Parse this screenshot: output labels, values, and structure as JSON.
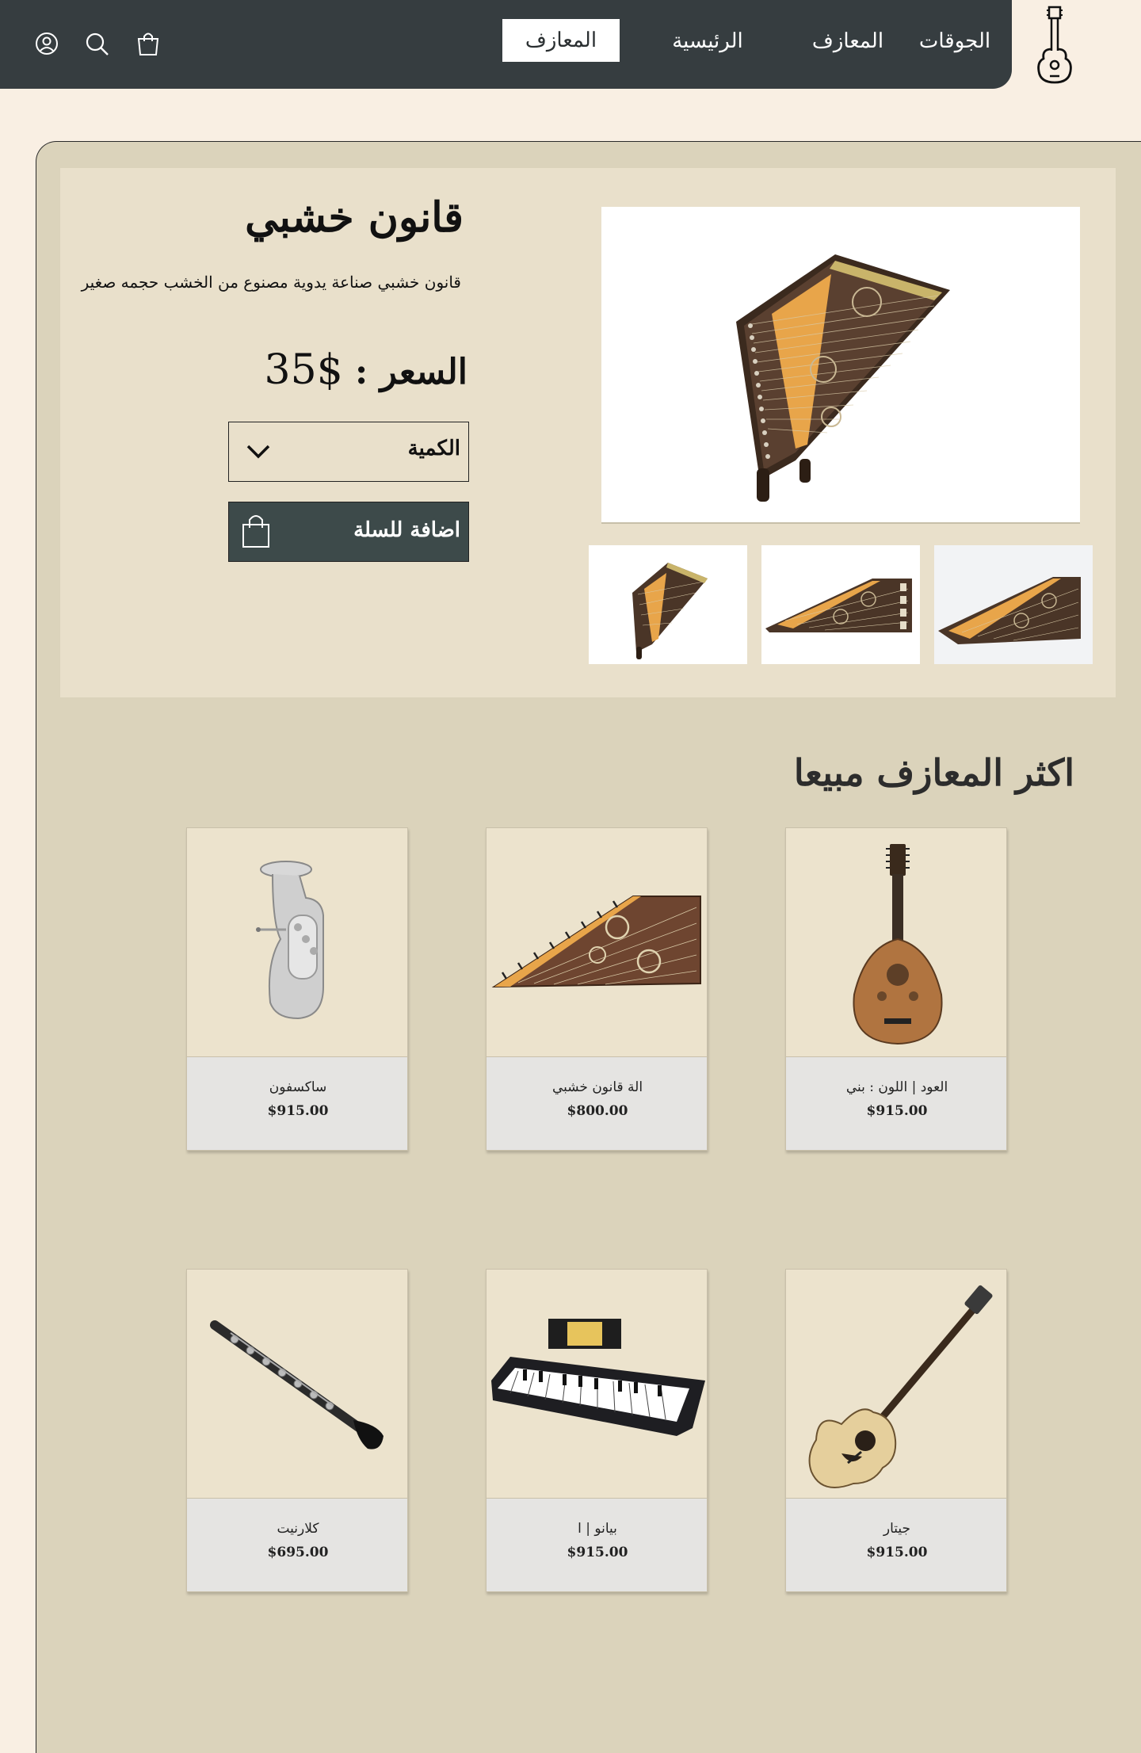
{
  "header": {
    "nav": {
      "troupes": "الجوقات",
      "instruments": "المعازف",
      "home": "الرئيسية",
      "active": "المعازف"
    },
    "icons": [
      "cart-icon",
      "search-icon",
      "user-icon"
    ],
    "brand_icon": "guitar-icon"
  },
  "product": {
    "title": "قانون خشبي",
    "description": "قانون خشبي صناعة يدوية مصنوع من الخشب حجمه صغير",
    "price_label": "السعر :",
    "price_value": "$35",
    "quantity_label": "الكمية",
    "add_to_cart_label": "اضافة للسلة"
  },
  "best_sellers": {
    "title": "اكثر المعازف مبيعا",
    "items": [
      {
        "name": "العود | اللون : بني",
        "price": "$915.00"
      },
      {
        "name": "الة قانون خشبي",
        "price": "$800.00"
      },
      {
        "name": "ساكسفون",
        "price": "$915.00"
      },
      {
        "name": "جيتار",
        "price": "$915.00"
      },
      {
        "name": "بيانو | ا",
        "price": "$915.00"
      },
      {
        "name": "كلارنيت",
        "price": "$695.00"
      }
    ]
  },
  "colors": {
    "header_bg": "#363d40",
    "page_bg": "#f9efe3",
    "panel_bg": "#dbd3bb",
    "product_box_bg": "#e9e0cb",
    "cart_button_bg": "#3d4a4a"
  }
}
